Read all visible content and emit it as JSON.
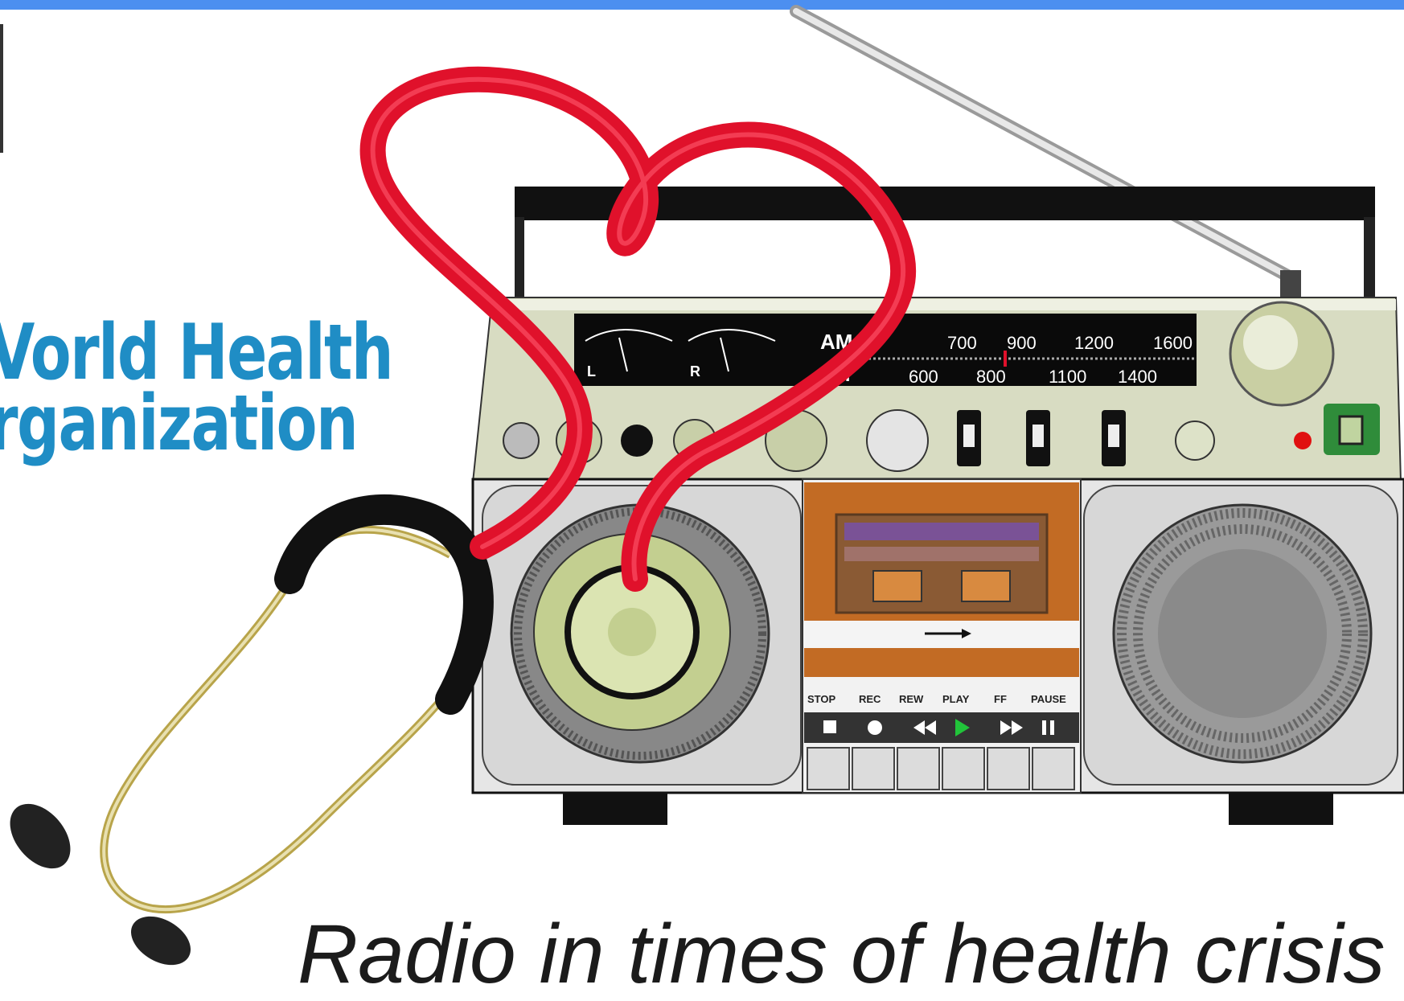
{
  "logo": {
    "line1": "Vorld Health",
    "line2": "rganization"
  },
  "radio": {
    "band_am": "AM",
    "band_fm": "FM",
    "meter_left": "L",
    "meter_right": "R",
    "am_scale": [
      "700",
      "900",
      "1200",
      "1600"
    ],
    "fm_scale": [
      "600",
      "800",
      "1100",
      "1400"
    ],
    "transport_labels": [
      "STOP",
      "REC",
      "REW",
      "PLAY",
      "FF",
      "PAUSE"
    ]
  },
  "tagline": "Radio in times of health crisis",
  "colors": {
    "top_bar": "#4c8ff0",
    "logo_blue": "#1f8dc5",
    "stethoscope_tube": "#e0112b"
  }
}
